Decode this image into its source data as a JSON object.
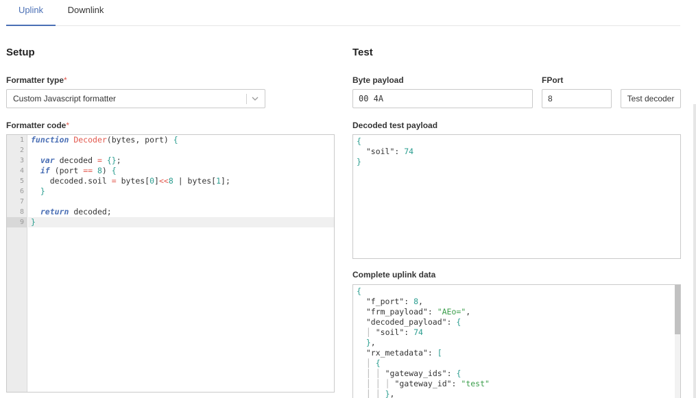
{
  "tabs": [
    {
      "label": "Uplink",
      "active": true
    },
    {
      "label": "Downlink",
      "active": false
    }
  ],
  "setup": {
    "heading": "Setup",
    "formatter_type_label": "Formatter type",
    "formatter_type_value": "Custom Javascript formatter",
    "formatter_code_label": "Formatter code",
    "required_mark": "*",
    "code_lines": [
      "1",
      "2",
      "3",
      "4",
      "5",
      "6",
      "7",
      "8",
      "9"
    ]
  },
  "test": {
    "heading": "Test",
    "byte_payload_label": "Byte payload",
    "byte_payload_value": "00 4A",
    "fport_label": "FPort",
    "fport_value": "8",
    "test_decoder_button": "Test decoder",
    "decoded_label": "Decoded test payload",
    "complete_label": "Complete uplink data"
  },
  "colors": {
    "accent": "#4a6fb5",
    "required": "#e2574c",
    "keyword": "#4a6fb5",
    "function_name": "#e2574c",
    "number": "#2a9d8f",
    "string": "#3a9d4a"
  },
  "icons": {
    "select_chevron": "chevron-down-icon"
  }
}
